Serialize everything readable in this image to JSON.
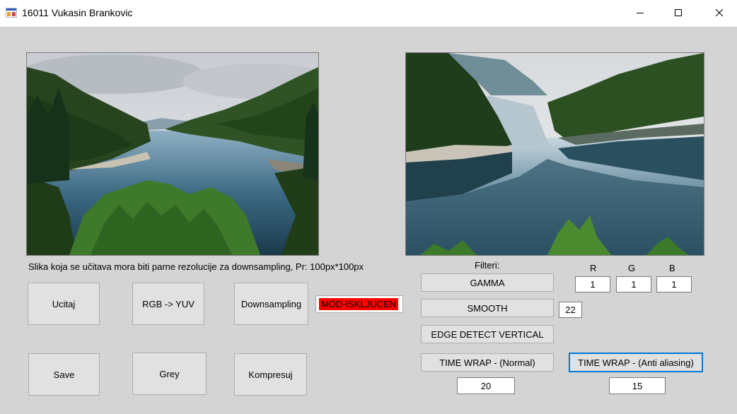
{
  "window": {
    "title": "16011 Vukasin Brankovic",
    "icon": "winforms-app-icon",
    "controls": [
      "minimize-icon",
      "maximize-icon",
      "close-icon"
    ]
  },
  "images": {
    "original": "mountain-lake-photo",
    "result": "warped-mountain-lake-photo"
  },
  "info_text": "Slika koja se učitava mora biti parne rezolucije za downsampling, Pr: 100px*100px",
  "buttons": {
    "ucitaj": "Ucitaj",
    "rgb_yuv": "RGB -> YUV",
    "downsampling": "Downsampling",
    "save": "Save",
    "grey": "Grey",
    "kompresuj": "Kompresuj"
  },
  "mod_status": {
    "text": "MOD-ISKLJUCEN",
    "color": "#ff0000"
  },
  "filters": {
    "title": "Filteri:",
    "gamma": "GAMMA",
    "smooth": "SMOOTH",
    "edge_detect": "EDGE DETECT VERTICAL",
    "time_wrap_normal": "TIME WRAP - (Normal)",
    "time_wrap_aa": "TIME WRAP - (Anti aliasing)"
  },
  "gamma": {
    "r_label": "R",
    "g_label": "G",
    "b_label": "B",
    "r": "1",
    "g": "1",
    "b": "1"
  },
  "smooth_value": "22",
  "time_wrap_normal_value": "20",
  "time_wrap_aa_value": "15",
  "colors": {
    "form_bg": "#d4d4d4",
    "button_bg": "#e1e1e1",
    "focus_border": "#0078d7"
  }
}
